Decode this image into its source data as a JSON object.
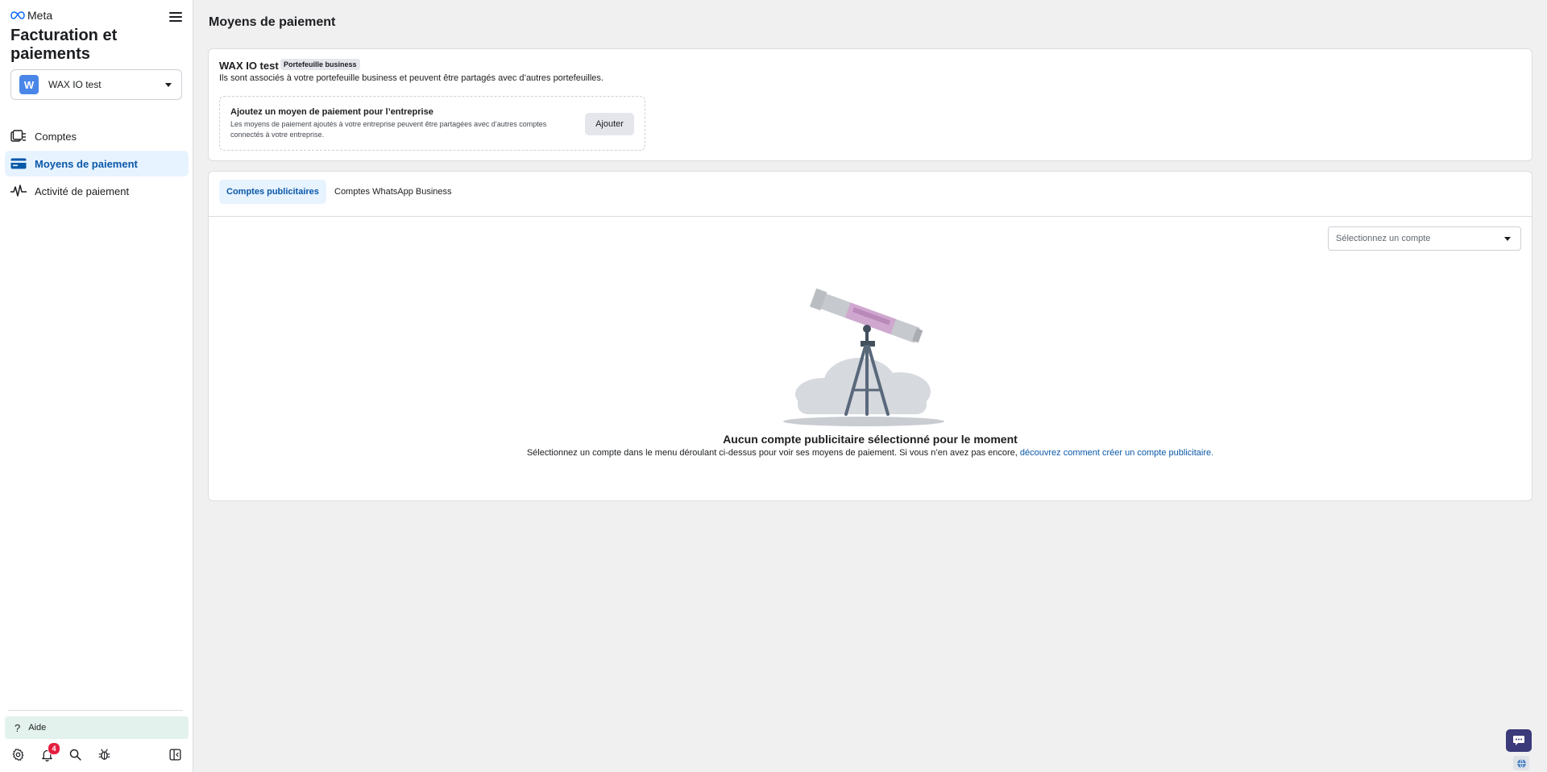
{
  "brand": {
    "logo_text": "Meta"
  },
  "sidebar": {
    "title": "Facturation et paiements",
    "account_selector": {
      "initial": "W",
      "name": "WAX IO test",
      "avatar_color": "#4a86e8"
    },
    "items": [
      {
        "label": "Comptes",
        "icon": "accounts-icon",
        "active": false
      },
      {
        "label": "Moyens de paiement",
        "icon": "credit-card-icon",
        "active": true
      },
      {
        "label": "Activité de paiement",
        "icon": "activity-pulse-icon",
        "active": false
      }
    ],
    "help_label": "Aide",
    "notification_count": "4"
  },
  "main": {
    "page_title": "Moyens de paiement",
    "business": {
      "name": "WAX IO test",
      "tag": "Portefeuille business",
      "description": "Ils sont associés à votre portefeuille business et peuvent être partagés avec d’autres portefeuilles."
    },
    "add_payment": {
      "title": "Ajoutez un moyen de paiement pour l’entreprise",
      "description": "Les moyens de paiement ajoutés à votre entreprise peuvent être partagées avec d’autres comptes connectés à votre entreprise.",
      "button_label": "Ajouter"
    },
    "tabs": [
      {
        "label": "Comptes publicitaires",
        "active": true
      },
      {
        "label": "Comptes WhatsApp Business",
        "active": false
      }
    ],
    "account_filter": {
      "placeholder": "Sélectionnez un compte"
    },
    "empty_state": {
      "title": "Aucun compte publicitaire sélectionné pour le moment",
      "description": "Sélectionnez un compte dans le menu déroulant ci-dessus pour voir ses moyens de paiement. Si vous n’en avez pas encore,",
      "link_text": "découvrez comment créer un compte publicitaire."
    }
  },
  "colors": {
    "accent": "#0a58a8",
    "active_bg": "#e7f3ff",
    "badge": "#e41e3f",
    "chat_button": "#3b3a7a"
  }
}
